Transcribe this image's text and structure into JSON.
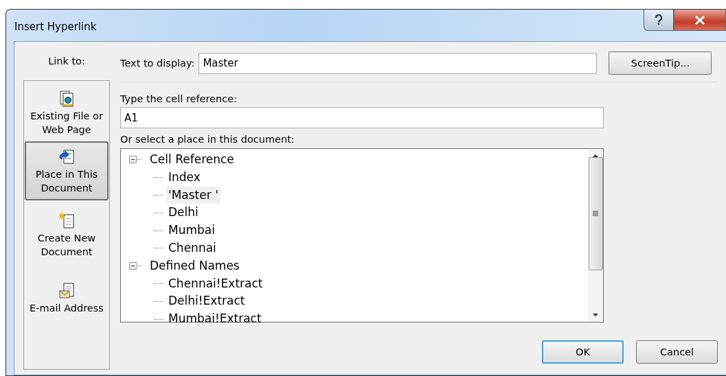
{
  "window": {
    "title": "Insert Hyperlink"
  },
  "link_to": {
    "label": "Link to:",
    "items": [
      {
        "label": "Existing File or Web Page",
        "kind": "file",
        "selected": false
      },
      {
        "label": "Place in This Document",
        "kind": "place",
        "selected": true
      },
      {
        "label": "Create New Document",
        "kind": "new",
        "selected": false
      },
      {
        "label": "E-mail Address",
        "kind": "email",
        "selected": false
      }
    ]
  },
  "text_to_display": {
    "label": "Text to display:",
    "value": "Master"
  },
  "screentip_button": "ScreenTip...",
  "cell_reference": {
    "label": "Type the cell reference:",
    "value": "A1"
  },
  "place_list": {
    "label": "Or select a place in this document:",
    "tree": [
      {
        "label": "Cell Reference",
        "expanded": true,
        "children": [
          {
            "label": "Index",
            "selected": false
          },
          {
            "label": "'Master '",
            "selected": true
          },
          {
            "label": "Delhi",
            "selected": false
          },
          {
            "label": "Mumbai",
            "selected": false
          },
          {
            "label": "Chennai",
            "selected": false
          }
        ]
      },
      {
        "label": "Defined Names",
        "expanded": true,
        "children": [
          {
            "label": "Chennai!Extract",
            "selected": false
          },
          {
            "label": "Delhi!Extract",
            "selected": false
          },
          {
            "label": "Mumbai!Extract",
            "selected": false
          }
        ]
      }
    ]
  },
  "buttons": [
    {
      "label": "OK",
      "default": true
    },
    {
      "label": "Cancel",
      "default": false
    }
  ]
}
